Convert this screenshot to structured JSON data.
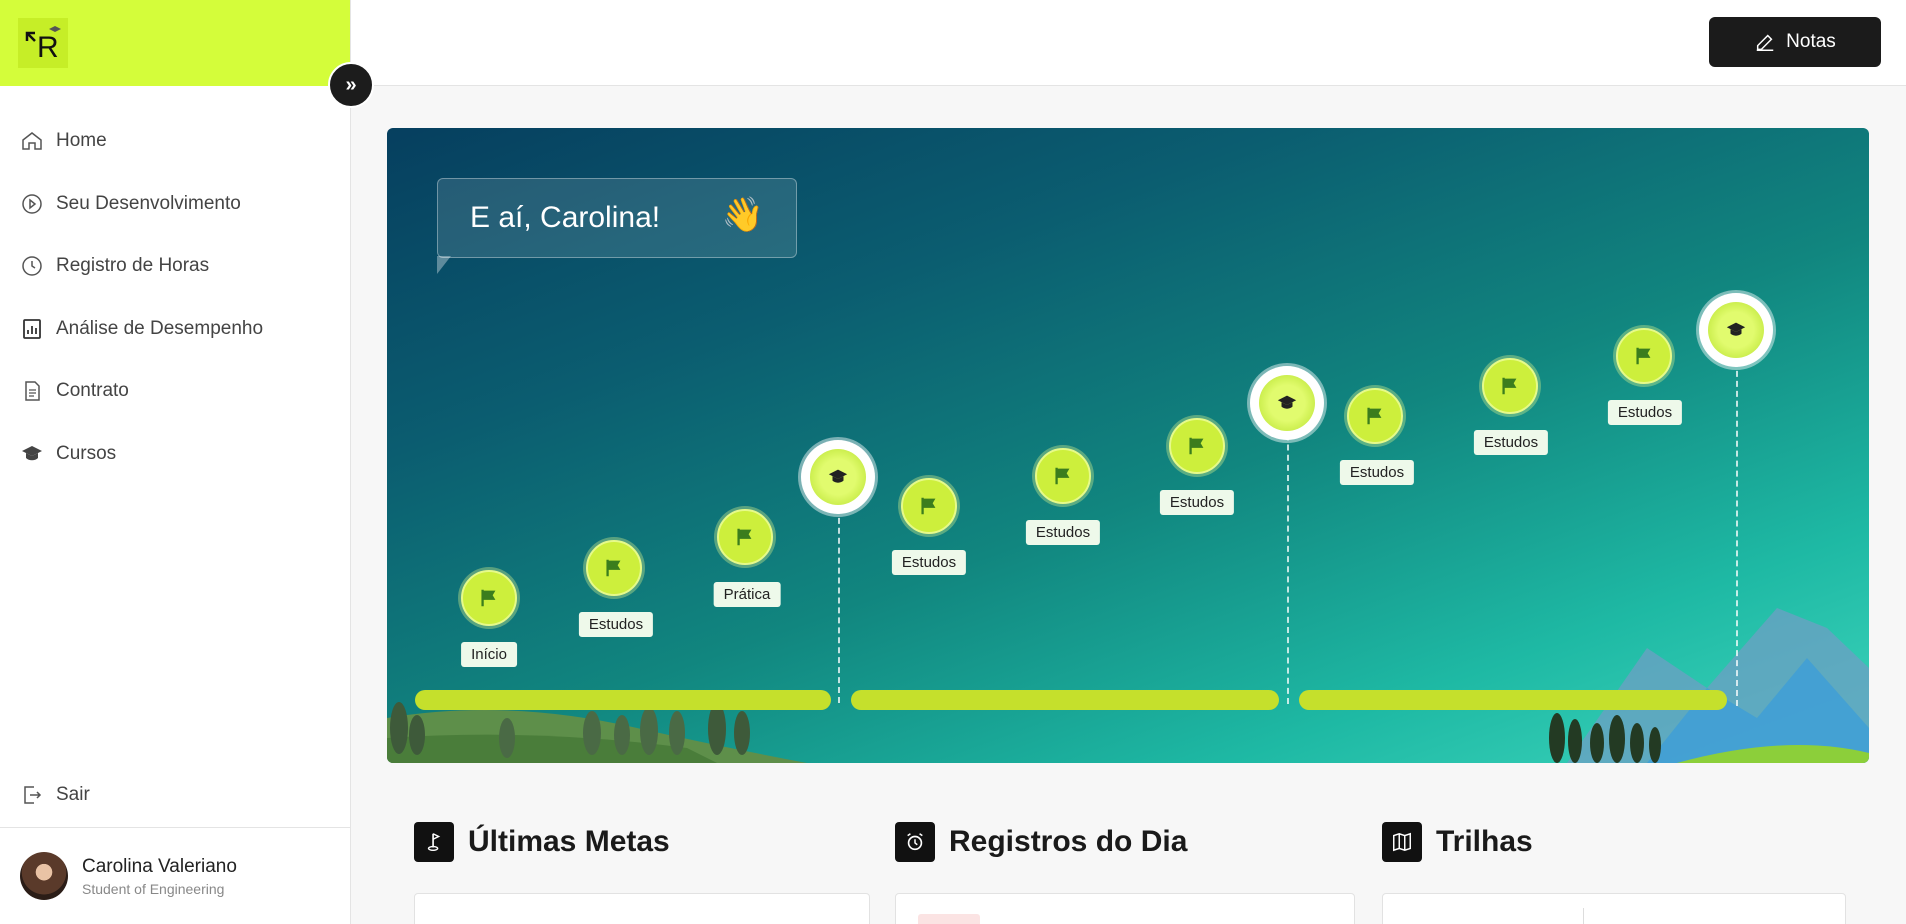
{
  "sidebar": {
    "logo_text": "R",
    "items": [
      {
        "label": "Home",
        "icon": "home-icon"
      },
      {
        "label": "Seu Desenvolvimento",
        "icon": "play-circle-icon"
      },
      {
        "label": "Registro de Horas",
        "icon": "clock-icon"
      },
      {
        "label": "Análise de Desempenho",
        "icon": "chart-icon"
      },
      {
        "label": "Contrato",
        "icon": "document-icon"
      },
      {
        "label": "Cursos",
        "icon": "graduation-cap-icon"
      }
    ],
    "logout_label": "Sair",
    "user": {
      "name": "Carolina Valeriano",
      "role": "Student of Engineering"
    }
  },
  "header": {
    "notes_label": "Notas"
  },
  "hero": {
    "greeting": "E aí, Carolina!",
    "labels": [
      "Início",
      "Estudos",
      "Prática",
      "Estudos",
      "Estudos",
      "Estudos",
      "Estudos",
      "Estudos",
      "Estudos"
    ]
  },
  "sections": {
    "goals_title": "Últimas Metas",
    "records_title": "Registros do Dia",
    "trails_title": "Trilhas"
  },
  "colors": {
    "accent": "#d4fd3a",
    "dark": "#1b1b1b",
    "track": "#c5e02c"
  }
}
